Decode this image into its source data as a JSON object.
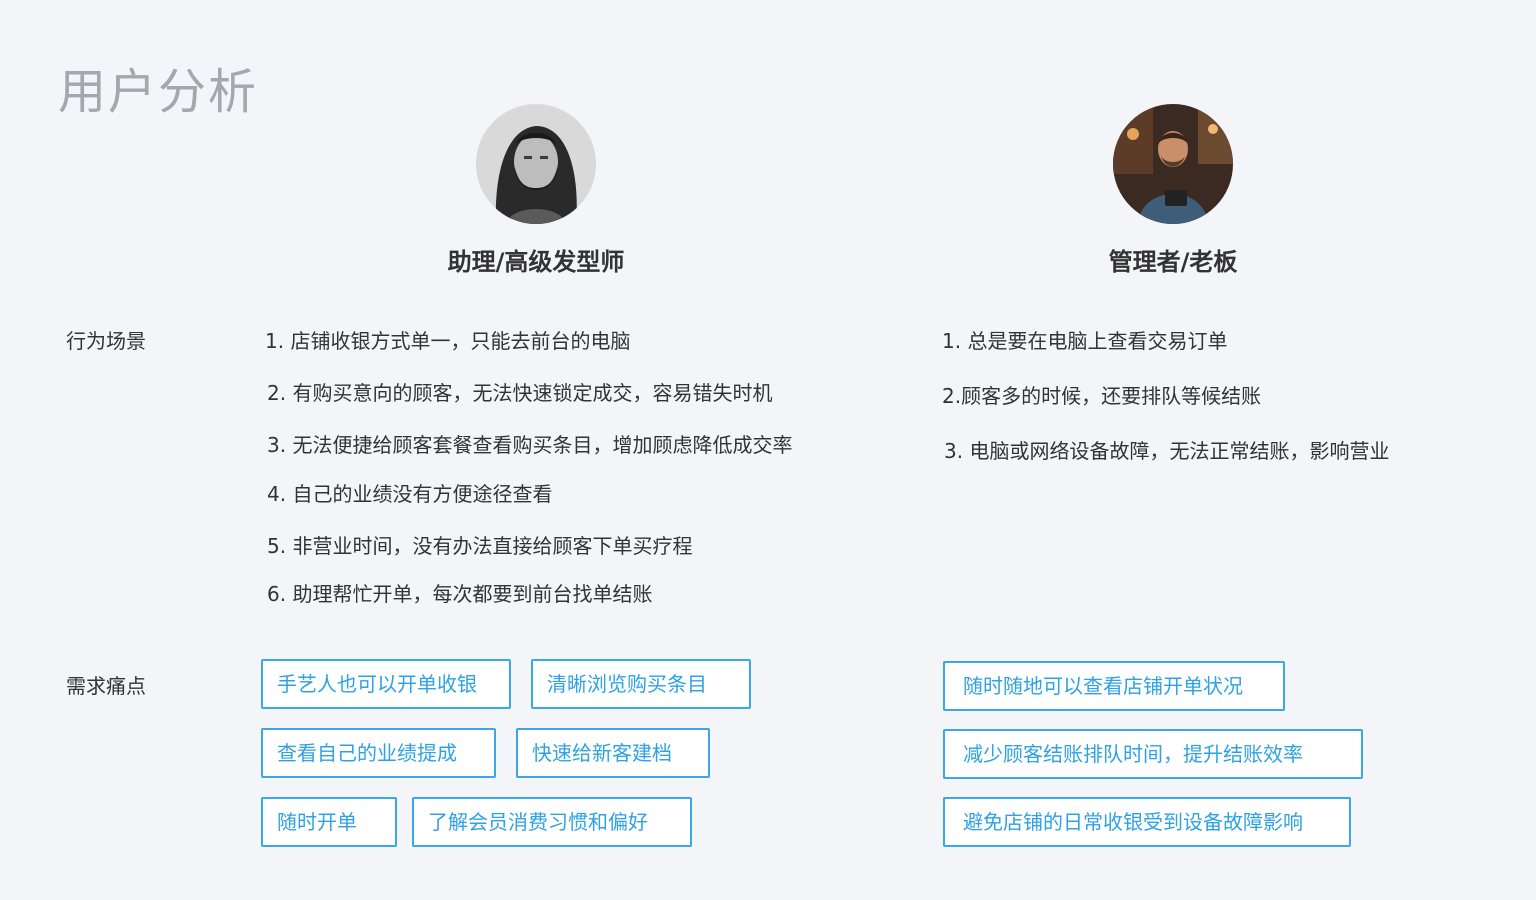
{
  "page": {
    "title": "用户分析"
  },
  "row_labels": {
    "behavior": "行为场景",
    "needs": "需求痛点"
  },
  "personas": [
    {
      "role": "助理/高级发型师",
      "avatar_icon": "bearded-long-hair-man-photo",
      "scenarios": [
        "1. 店铺收银方式单一，只能去前台的电脑",
        "2. 有购买意向的顾客，无法快速锁定成交，容易错失时机",
        "3. 无法便捷给顾客套餐查看购买条目，增加顾虑降低成交率",
        "4. 自己的业绩没有方便途径查看",
        "5. 非营业时间，没有办法直接给顾客下单买疗程",
        "6. 助理帮忙开单，每次都要到前台找单结账"
      ],
      "needs": [
        "手艺人也可以开单收银",
        "清晰浏览购买条目",
        "查看自己的业绩提成",
        "快速给新客建档",
        "随时开单",
        "了解会员消费习惯和偏好"
      ]
    },
    {
      "role": "管理者/老板",
      "avatar_icon": "manager-with-tablet-photo",
      "scenarios": [
        "1. 总是要在电脑上查看交易订单",
        "2.顾客多的时候，还要排队等候结账",
        "3. 电脑或网络设备故障，无法正常结账，影响营业"
      ],
      "needs": [
        "随时随地可以查看店铺开单状况",
        "减少顾客结账排队时间，提升结账效率",
        "避免店铺的日常收银受到设备故障影响"
      ]
    }
  ],
  "colors": {
    "accent": "#38a8e6",
    "title_gray": "#a3a7ae",
    "background": "#f4f5f8"
  }
}
